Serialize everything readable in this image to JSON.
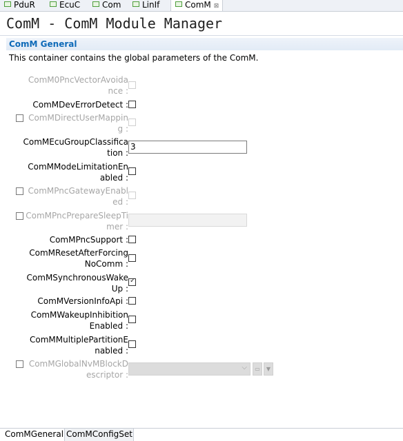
{
  "tabs": [
    {
      "label": "PduR"
    },
    {
      "label": "EcuC"
    },
    {
      "label": "Com"
    },
    {
      "label": "LinIf"
    },
    {
      "label": "ComM",
      "close": "⊠"
    }
  ],
  "title": "ComM - ComM Module Manager",
  "section": {
    "title": "ComM General",
    "description": "This container contains the global parameters of the ComM."
  },
  "params": {
    "p0": {
      "l1": "ComM0PncVectorAvoida",
      "l2": "nce :"
    },
    "p1": {
      "l1": "ComMDevErrorDetect :"
    },
    "p2": {
      "l1": "ComMDirectUserMappin",
      "l2": "g :"
    },
    "p3": {
      "l1": "ComMEcuGroupClassifica",
      "l2": "tion :",
      "value": "3"
    },
    "p4": {
      "l1": "ComMModeLimitationEn",
      "l2": "abled :"
    },
    "p5": {
      "l1": "ComMPncGatewayEnabl",
      "l2": "ed :"
    },
    "p6": {
      "l1": "ComMPncPrepareSleepTi",
      "l2": "mer :",
      "value": ""
    },
    "p7": {
      "l1": "ComMPncSupport :"
    },
    "p8": {
      "l1": "ComMResetAfterForcing",
      "l2": "NoComm :"
    },
    "p9": {
      "l1": "ComMSynchronousWake",
      "l2": "Up :",
      "checked": true
    },
    "p10": {
      "l1": "ComMVersionInfoApi :"
    },
    "p11": {
      "l1": "ComMWakeupInhibition",
      "l2": "Enabled :"
    },
    "p12": {
      "l1": "ComMMultiplePartitionE",
      "l2": "nabled :"
    },
    "p13": {
      "l1": "ComMGlobalNvMBlockD",
      "l2": "escriptor :",
      "value": ""
    }
  },
  "bottom_tabs": [
    {
      "label": "ComMGeneral"
    },
    {
      "label": "ComMConfigSet"
    }
  ]
}
